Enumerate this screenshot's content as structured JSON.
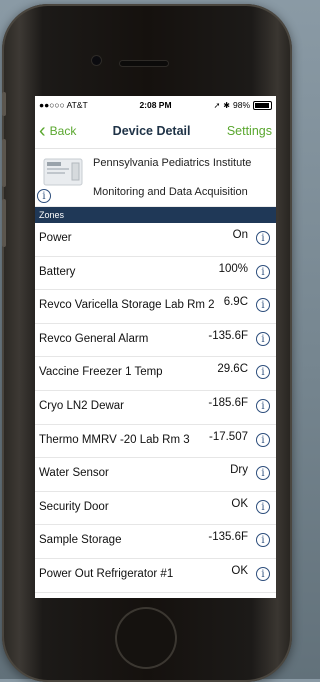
{
  "status_bar": {
    "carrier": "●●○○○ AT&T",
    "time": "2:08 PM",
    "battery": "98%"
  },
  "nav": {
    "back_label": "Back",
    "title": "Device Detail",
    "settings_label": "Settings"
  },
  "device": {
    "line1": "Pennsylvania Pediatrics Institute",
    "line2": "Monitoring and Data Acquisition"
  },
  "zones_header": "Zones",
  "zones": [
    {
      "name": "Power",
      "value": "On"
    },
    {
      "name": "Battery",
      "value": "100%"
    },
    {
      "name": "Revco Varicella Storage Lab Rm 2",
      "value": "6.9C"
    },
    {
      "name": "Revco General Alarm",
      "value": "-135.6F"
    },
    {
      "name": "Vaccine Freezer 1 Temp",
      "value": "29.6C"
    },
    {
      "name": "Cryo LN2 Dewar",
      "value": "-185.6F"
    },
    {
      "name": "Thermo MMRV -20 Lab Rm 3",
      "value": "-17.507"
    },
    {
      "name": "Water Sensor",
      "value": "Dry"
    },
    {
      "name": "Security Door",
      "value": "OK"
    },
    {
      "name": "Sample Storage",
      "value": "-135.6F"
    },
    {
      "name": "Power Out Refrigerator #1",
      "value": "OK"
    }
  ],
  "colors": {
    "accent": "#5aa72f",
    "header_bar": "#1f3857",
    "info_icon": "#2d4e7c"
  },
  "icons": {
    "info": "info-circle-icon"
  }
}
